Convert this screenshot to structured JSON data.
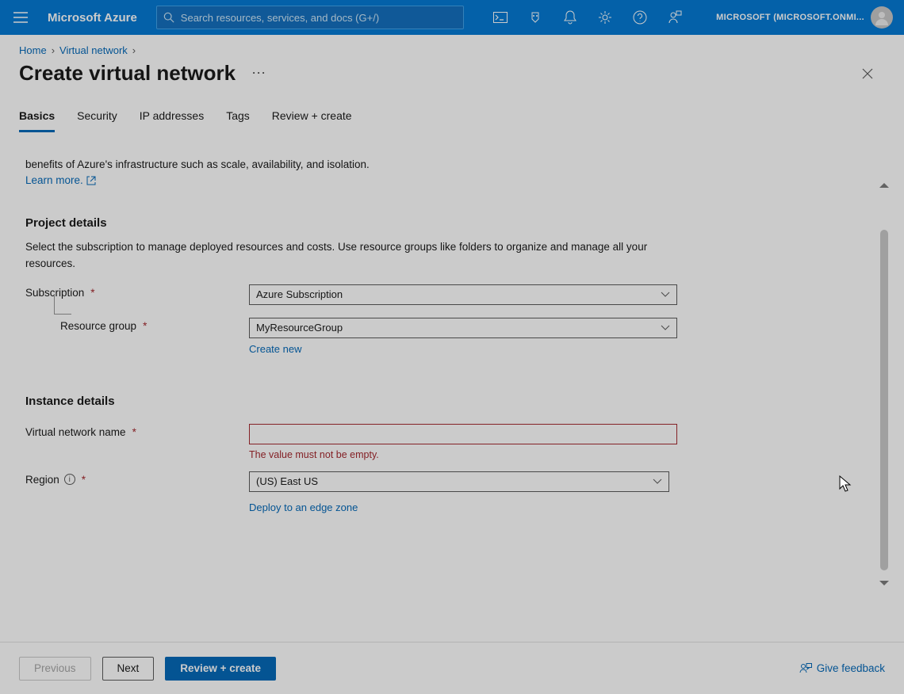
{
  "topbar": {
    "brand": "Microsoft Azure",
    "search_placeholder": "Search resources, services, and docs (G+/)",
    "account": "MICROSOFT (MICROSOFT.ONMI..."
  },
  "breadcrumb": {
    "items": [
      "Home",
      "Virtual network"
    ]
  },
  "page": {
    "title": "Create virtual network"
  },
  "tabs": {
    "items": [
      {
        "label": "Basics",
        "active": true
      },
      {
        "label": "Security",
        "active": false
      },
      {
        "label": "IP addresses",
        "active": false
      },
      {
        "label": "Tags",
        "active": false
      },
      {
        "label": "Review + create",
        "active": false
      }
    ]
  },
  "intro": {
    "line": "benefits of Azure's infrastructure such as scale, availability, and isolation.",
    "learn_more": "Learn more."
  },
  "project": {
    "heading": "Project details",
    "desc": "Select the subscription to manage deployed resources and costs. Use resource groups like folders to organize and manage all your resources.",
    "subscription_label": "Subscription",
    "subscription_value": "Azure Subscription",
    "resource_group_label": "Resource group",
    "resource_group_value": "MyResourceGroup",
    "create_new": "Create new"
  },
  "instance": {
    "heading": "Instance details",
    "vnet_name_label": "Virtual network name",
    "vnet_name_value": "",
    "vnet_name_error": "The value must not be empty.",
    "region_label": "Region",
    "region_value": "(US) East US",
    "edge_zone_link": "Deploy to an edge zone"
  },
  "footer": {
    "previous": "Previous",
    "next": "Next",
    "review_create": "Review + create",
    "feedback": "Give feedback"
  }
}
